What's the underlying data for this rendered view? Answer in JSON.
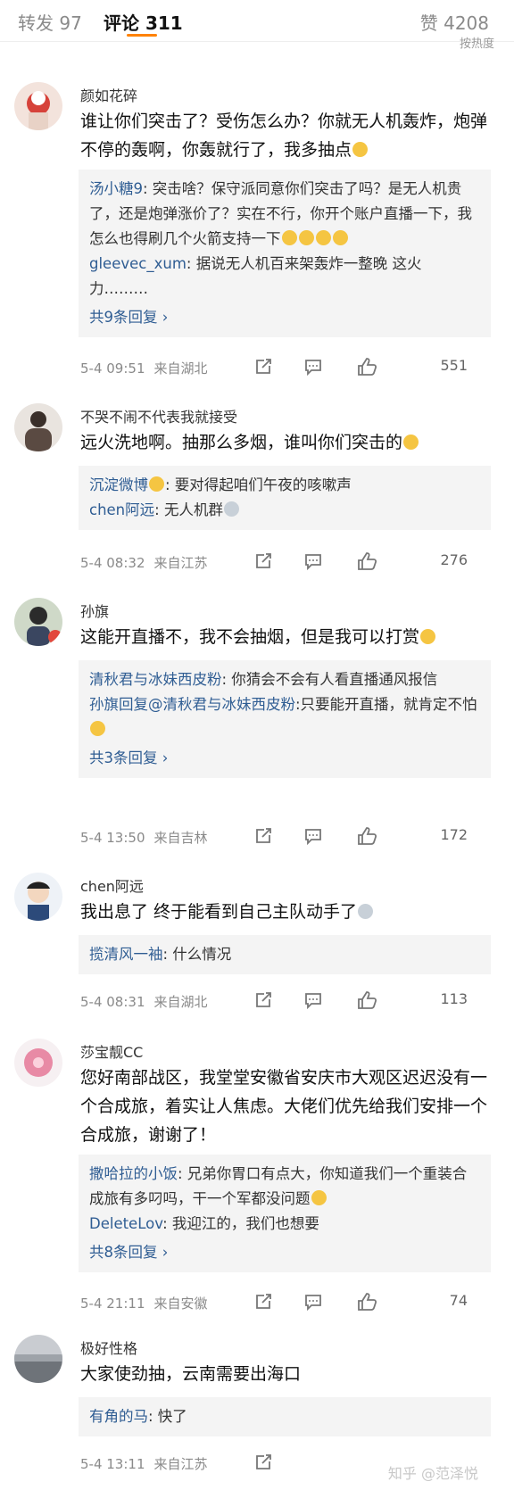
{
  "tabs": {
    "repost": "转发 97",
    "comments": "评论 311",
    "likes": "赞 4208",
    "sort": "按热度"
  },
  "comments": [
    {
      "user": "颜如花碎",
      "text": "谁让你们突击了？受伤怎么办？你就无人机轰炸，炮弹不停的轰啊，你轰就行了，我多抽点",
      "replies": [
        {
          "user": "汤小糖9",
          "text": ": 突击啥？保守派同意你们突击了吗？是无人机贵了，还是炮弹涨价了？实在不行，你开个账户直播一下，我怎么也得刷几个火箭支持一下"
        },
        {
          "user": "gleevec_xum",
          "text": ": 据说无人机百来架轰炸一整晚 这火力………"
        }
      ],
      "more": "共9条回复 ›",
      "time": "5-4 09:51",
      "location": "来自湖北",
      "likes": "551"
    },
    {
      "user": "不哭不闹不代表我就接受",
      "text": "远火洗地啊。抽那么多烟，谁叫你们突击的",
      "replies": [
        {
          "user": "沉淀微博",
          "text": ": 要对得起咱们午夜的咳嗽声"
        },
        {
          "user": "chen阿远",
          "text": ": 无人机群"
        }
      ],
      "more": "",
      "time": "5-4 08:32",
      "location": "来自江苏",
      "likes": "276"
    },
    {
      "user": "孙旗",
      "text": "这能开直播不，我不会抽烟，但是我可以打赏",
      "replies": [
        {
          "user": "清秋君与冰妹西皮粉",
          "text": ": 你猜会不会有人看直播通风报信"
        },
        {
          "user": "孙旗回复@清秋君与冰妹西皮粉",
          "text": ":只要能开直播，就肯定不怕"
        }
      ],
      "more": "共3条回复 ›",
      "time": "5-4 13:50",
      "location": "来自吉林",
      "likes": "172"
    },
    {
      "user": "chen阿远",
      "text": "我出息了  终于能看到自己主队动手了",
      "replies": [
        {
          "user": "揽清风一袖",
          "text": ": 什么情况"
        }
      ],
      "more": "",
      "time": "5-4 08:31",
      "location": "来自湖北",
      "likes": "113"
    },
    {
      "user": "莎宝靓CC",
      "text": "您好南部战区，我堂堂安徽省安庆市大观区迟迟没有一个合成旅，着实让人焦虑。大佬们优先给我们安排一个合成旅，谢谢了！",
      "replies": [
        {
          "user": "撒哈拉的小饭",
          "text": ": 兄弟你胃口有点大，你知道我们一个重装合成旅有多叼吗，干一个军都没问题"
        },
        {
          "user": "DeleteLov",
          "text": ": 我迎江的，我们也想要"
        }
      ],
      "more": "共8条回复 ›",
      "time": "5-4 21:11",
      "location": "来自安徽",
      "likes": "74"
    },
    {
      "user": "极好性格",
      "text": "大家使劲抽，云南需要出海口",
      "replies": [
        {
          "user": "有角的马",
          "text": ": 快了"
        }
      ],
      "more": "",
      "time": "5-4 13:11",
      "location": "来自江苏",
      "likes": ""
    }
  ],
  "watermark": "知乎 @范泽悦",
  "colors": {
    "accent": "#ff8200",
    "reply_user": "#2f5d93"
  }
}
